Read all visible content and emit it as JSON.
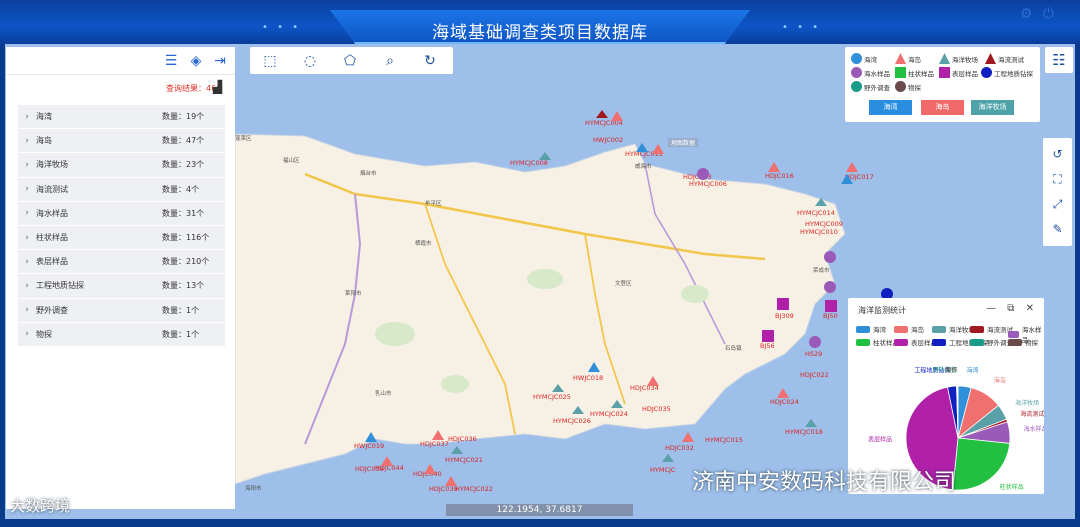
{
  "header": {
    "title": "海域基础调查类项目数据库",
    "dots_left": "• • •",
    "dots_right": "• • •"
  },
  "top_icons": {
    "gear": "gear-icon",
    "power": "power-icon"
  },
  "left_panel": {
    "query_result_label": "查询结果：466",
    "categories": [
      {
        "name": "海湾",
        "count": "数量：19个"
      },
      {
        "name": "海岛",
        "count": "数量：47个"
      },
      {
        "name": "海洋牧场",
        "count": "数量：23个"
      },
      {
        "name": "海流测试",
        "count": "数量：4个"
      },
      {
        "name": "海水样品",
        "count": "数量：31个"
      },
      {
        "name": "柱状样品",
        "count": "数量：116个"
      },
      {
        "name": "表层样品",
        "count": "数量：210个"
      },
      {
        "name": "工程地质钻探",
        "count": "数量：13个"
      },
      {
        "name": "野外调查",
        "count": "数量：1个"
      },
      {
        "name": "物探",
        "count": "数量：1个"
      }
    ]
  },
  "legend": {
    "items": [
      {
        "label": "海湾",
        "color": "#2f8fd8"
      },
      {
        "label": "海岛",
        "color": "#f07070"
      },
      {
        "label": "海洋牧场",
        "color": "#5aa0a8"
      },
      {
        "label": "海流测试",
        "color": "#a01820"
      },
      {
        "label": "海水样品",
        "color": "#9a5ab8"
      },
      {
        "label": "柱状样品",
        "color": "#22c040"
      },
      {
        "label": "表层样品",
        "color": "#b020a8"
      },
      {
        "label": "工程地质钻探",
        "color": "#1020c0"
      },
      {
        "label": "野外调查",
        "color": "#1a9c8a"
      },
      {
        "label": "物探",
        "color": "#6a4a4a"
      }
    ],
    "buttons": [
      {
        "label": "海湾",
        "color": "#2a8ee0"
      },
      {
        "label": "海岛",
        "color": "#f06a6a"
      },
      {
        "label": "海洋牧场",
        "color": "#4fa2a8"
      }
    ]
  },
  "map": {
    "credit": "地图数据",
    "coordinates": "122.1954, 37.6817",
    "place_labels": [
      {
        "text": "烟台市"
      },
      {
        "text": "威海市"
      },
      {
        "text": "福山区"
      },
      {
        "text": "牟平区"
      },
      {
        "text": "莱阳市"
      },
      {
        "text": "乳山市"
      },
      {
        "text": "海阳市"
      },
      {
        "text": "文登区"
      },
      {
        "text": "荣成市"
      },
      {
        "text": "栖霞市"
      },
      {
        "text": "蓬莱区"
      },
      {
        "text": "石岛镇"
      }
    ],
    "markers": [
      {
        "label": "HYMCJC004"
      },
      {
        "label": "HWJC002"
      },
      {
        "label": "HYMCJC011"
      },
      {
        "label": "HYMCJC008"
      },
      {
        "label": "HDJC003"
      },
      {
        "label": "HYMCJC006"
      },
      {
        "label": "HDJC016"
      },
      {
        "label": "HDJC017"
      },
      {
        "label": "HYMCJC009"
      },
      {
        "label": "HYMCJC010"
      },
      {
        "label": "HYMCJC014"
      },
      {
        "label": "BJ309"
      },
      {
        "label": "BJ50"
      },
      {
        "label": "BJ56"
      },
      {
        "label": "HS29"
      },
      {
        "label": "HDJC022"
      },
      {
        "label": "HWJC018"
      },
      {
        "label": "HYMCJC025"
      },
      {
        "label": "HDJC034"
      },
      {
        "label": "HYMCJC026"
      },
      {
        "label": "HYMCJC024"
      },
      {
        "label": "HDJC035"
      },
      {
        "label": "HDJC024"
      },
      {
        "label": "HYMCJC018"
      },
      {
        "label": "HYMCJC015"
      },
      {
        "label": "HDJC032"
      },
      {
        "label": "HWJC019"
      },
      {
        "label": "HDJC036"
      },
      {
        "label": "HDJC037"
      },
      {
        "label": "HYMCJC021"
      },
      {
        "label": "HDJC038"
      },
      {
        "label": "HDJC044"
      },
      {
        "label": "HDJC040"
      },
      {
        "label": "HDJC039"
      },
      {
        "label": "HYMCJC022"
      },
      {
        "label": "HYMCJC"
      }
    ]
  },
  "pie_panel": {
    "title": "海洋监测统计",
    "window_controls": "— ⧉ ✕"
  },
  "chart_data": {
    "type": "pie",
    "title": "海洋监测统计",
    "categories": [
      "海湾",
      "海岛",
      "海洋牧场",
      "海流测试",
      "海水样品",
      "柱状样品",
      "表层样品",
      "工程地质钻探",
      "野外调查",
      "物探"
    ],
    "values": [
      19,
      47,
      23,
      4,
      31,
      116,
      210,
      13,
      1,
      1
    ],
    "colors": [
      "#2f8fd8",
      "#f07070",
      "#5aa0a8",
      "#a01820",
      "#9a5ab8",
      "#22c040",
      "#b020a8",
      "#1020c0",
      "#1a9c8a",
      "#6a4a4a"
    ],
    "legend_position": "top"
  },
  "watermarks": {
    "right": "济南中安数码科技有限公司",
    "left": "大数跨境"
  }
}
